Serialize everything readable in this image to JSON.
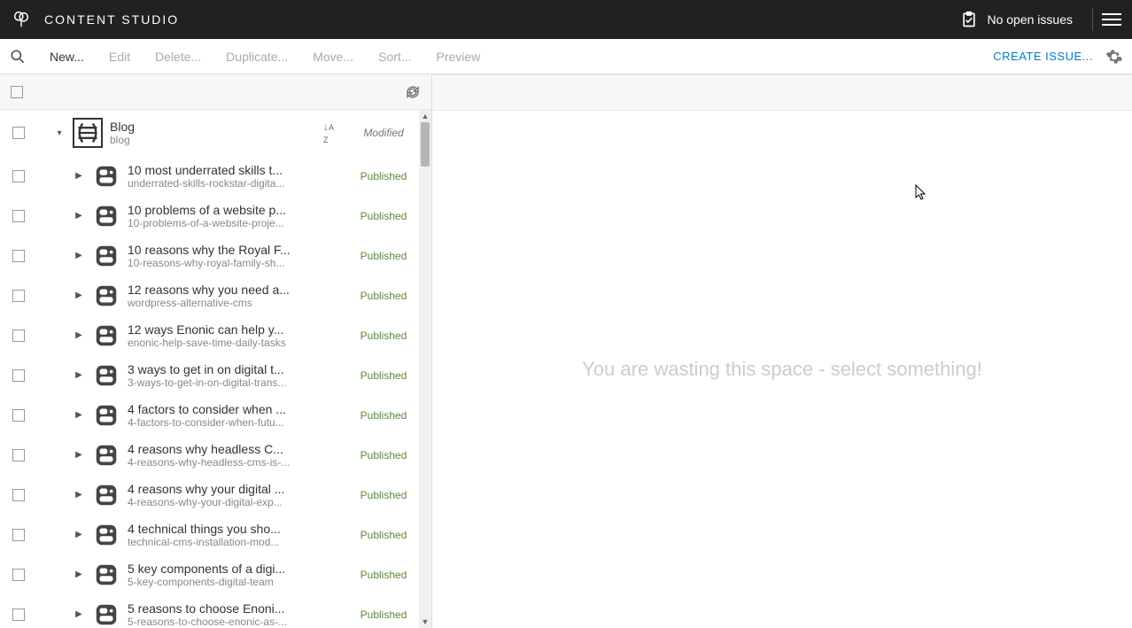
{
  "topbar": {
    "title": "CONTENT STUDIO",
    "issues_label": "No open issues"
  },
  "toolbar": {
    "new": "New...",
    "edit": "Edit",
    "delete": "Delete...",
    "duplicate": "Duplicate...",
    "move": "Move...",
    "sort": "Sort...",
    "preview": "Preview",
    "create_issue": "CREATE ISSUE..."
  },
  "tree": {
    "parent": {
      "title": "Blog",
      "path": "blog",
      "status": "Modified"
    },
    "items": [
      {
        "title": "10 most underrated skills t...",
        "path": "underrated-skills-rockstar-digita...",
        "status": "Published"
      },
      {
        "title": "10 problems of a website p...",
        "path": "10-problems-of-a-website-proje...",
        "status": "Published"
      },
      {
        "title": "10 reasons why the Royal F...",
        "path": "10-reasons-why-royal-family-sh...",
        "status": "Published"
      },
      {
        "title": "12 reasons why you need a...",
        "path": "wordpress-alternative-cms",
        "status": "Published"
      },
      {
        "title": "12 ways Enonic can help y...",
        "path": "enonic-help-save-time-daily-tasks",
        "status": "Published"
      },
      {
        "title": "3 ways to get in on digital t...",
        "path": "3-ways-to-get-in-on-digital-trans...",
        "status": "Published"
      },
      {
        "title": "4 factors to consider when ...",
        "path": "4-factors-to-consider-when-futu...",
        "status": "Published"
      },
      {
        "title": "4 reasons why headless C...",
        "path": "4-reasons-why-headless-cms-is-...",
        "status": "Published"
      },
      {
        "title": "4 reasons why your digital ...",
        "path": "4-reasons-why-your-digital-exp...",
        "status": "Published"
      },
      {
        "title": "4 technical things you sho...",
        "path": "technical-cms-installation-mod...",
        "status": "Published"
      },
      {
        "title": "5 key components of a digi...",
        "path": "5-key-components-digital-team",
        "status": "Published"
      },
      {
        "title": "5 reasons to choose Enoni...",
        "path": "5-reasons-to-choose-enonic-as-...",
        "status": "Published"
      }
    ]
  },
  "right_panel": {
    "placeholder": "You are wasting this space - select something!"
  }
}
